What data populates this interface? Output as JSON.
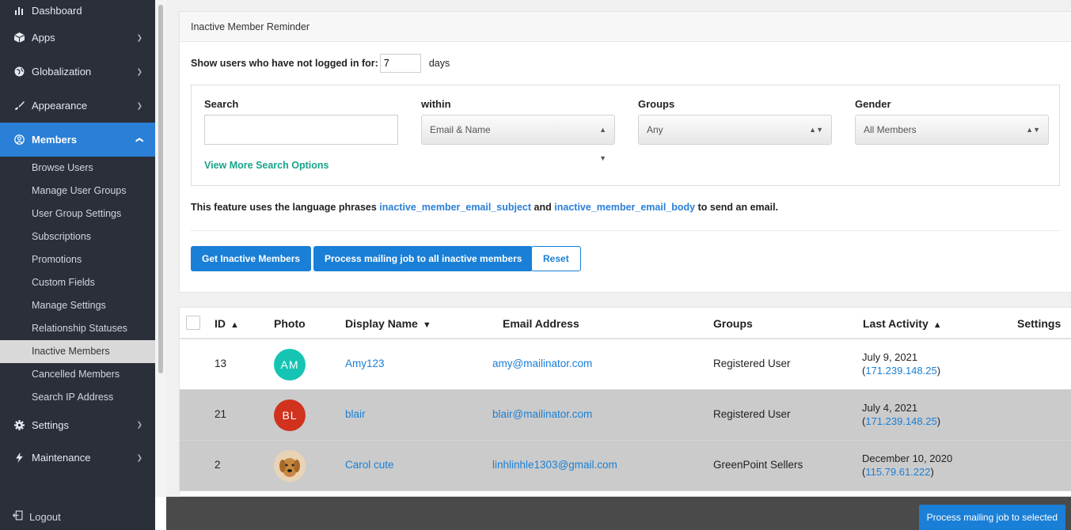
{
  "sidebar": {
    "dashboard": "Dashboard",
    "apps": "Apps",
    "globalization": "Globalization",
    "appearance": "Appearance",
    "members": "Members",
    "members_sub": [
      "Browse Users",
      "Manage User Groups",
      "User Group Settings",
      "Subscriptions",
      "Promotions",
      "Custom Fields",
      "Manage Settings",
      "Relationship Statuses",
      "Inactive Members",
      "Cancelled Members",
      "Search IP Address"
    ],
    "settings": "Settings",
    "maintenance": "Maintenance",
    "logout": "Logout"
  },
  "panel": {
    "title": "Inactive Member Reminder",
    "days_label": "Show users who have not logged in for:",
    "days_value": "7",
    "days_unit": "days",
    "search_label": "Search",
    "search_value": "",
    "within_label": "within",
    "within_value": "Email & Name",
    "groups_label": "Groups",
    "groups_value": "Any",
    "gender_label": "Gender",
    "gender_value": "All Members",
    "more_options": "View More Search Options",
    "note_prefix": "This feature uses the language phrases",
    "note_phrase1": "inactive_member_email_subject",
    "note_and": "and",
    "note_phrase2": "inactive_member_email_body",
    "note_suffix": "to send an email.",
    "btn_get": "Get Inactive Members",
    "btn_process_all": "Process mailing job to all inactive members",
    "btn_reset": "Reset"
  },
  "table": {
    "headers": {
      "id": "ID",
      "photo": "Photo",
      "display_name": "Display Name",
      "email": "Email Address",
      "groups": "Groups",
      "last_activity": "Last Activity",
      "settings": "Settings"
    },
    "rows": [
      {
        "id": "13",
        "initials": "AM",
        "avatar_color": "#16c4b4",
        "name": "Amy123",
        "email": "amy@mailinator.com",
        "group": "Registered User",
        "date": "July 9, 2021",
        "ip": "171.239.148.25"
      },
      {
        "id": "21",
        "initials": "BL",
        "avatar_color": "#d0321e",
        "name": "blair",
        "email": "blair@mailinator.com",
        "group": "Registered User",
        "date": "July 4, 2021",
        "ip": "171.239.148.25"
      },
      {
        "id": "2",
        "initials": "",
        "avatar_color": "#e9d3b6",
        "name": "Carol cute",
        "email": "linhlinhle1303@gmail.com",
        "group": "GreenPoint Sellers",
        "date": "December 10, 2020",
        "ip": "115.79.61.222"
      }
    ]
  },
  "bottom": {
    "process_selected": "Process mailing job to selected"
  },
  "colors": {
    "sidebar_bg": "#2b2f3a",
    "accent": "#1a7fd6",
    "link_green": "#1aa38a"
  }
}
